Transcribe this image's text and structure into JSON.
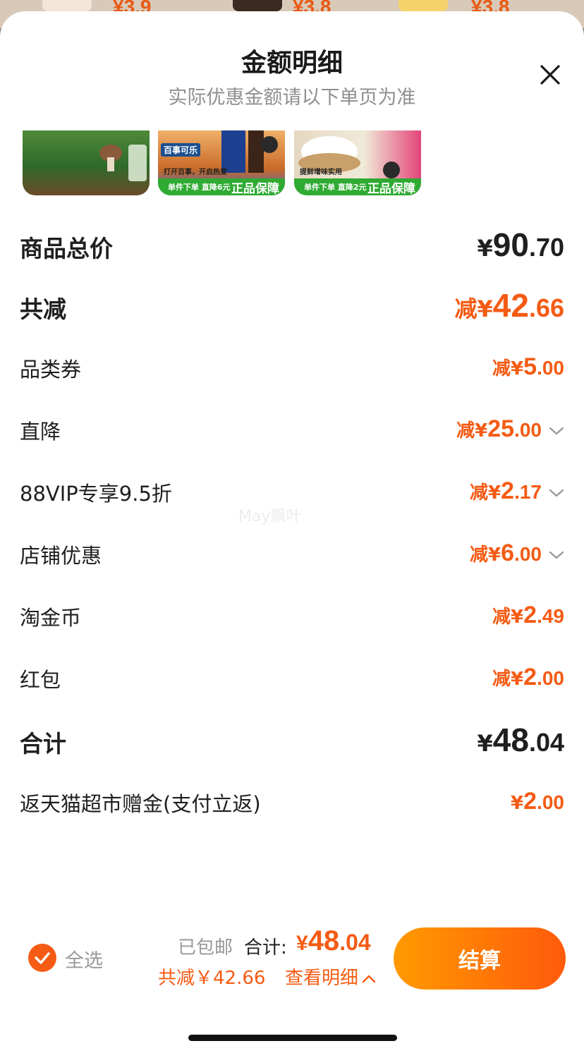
{
  "background": {
    "prices": [
      "¥3.9",
      "¥3.8",
      "¥3.8"
    ]
  },
  "sheet": {
    "title": "金额明细",
    "subtitle": "实际优惠金额请以下单页为准",
    "close_icon": "close-icon"
  },
  "thumbnails": [
    {
      "caption": "",
      "badge": "",
      "tag_left": "",
      "tag_right": ""
    },
    {
      "caption": "打开百事，开启热爱",
      "badge": "百事可乐",
      "tag_left": "单件下单 直降6元",
      "tag_right": "正品保障"
    },
    {
      "caption": "提鲜增味实用",
      "badge": "",
      "tag_left": "单件下单 直降2元",
      "tag_right": "正品保障"
    }
  ],
  "rows": {
    "subtotal": {
      "label": "商品总价",
      "prefix": "¥",
      "int": "90",
      "dec": ".70"
    },
    "total_discount": {
      "label": "共减",
      "prefix": "减¥",
      "int": "42",
      "dec": ".66"
    },
    "coupon": {
      "label": "品类券",
      "prefix": "减¥",
      "int": "5",
      "dec": ".00"
    },
    "direct": {
      "label": "直降",
      "prefix": "减¥",
      "int": "25",
      "dec": ".00"
    },
    "vip": {
      "label": "88VIP专享9.5折",
      "prefix": "减¥",
      "int": "2",
      "dec": ".17"
    },
    "store": {
      "label": "店铺优惠",
      "prefix": "减¥",
      "int": "6",
      "dec": ".00"
    },
    "coins": {
      "label": "淘金币",
      "prefix": "减¥",
      "int": "2",
      "dec": ".49"
    },
    "redpacket": {
      "label": "红包",
      "prefix": "减¥",
      "int": "2",
      "dec": ".00"
    },
    "total": {
      "label": "合计",
      "prefix": "¥",
      "int": "48",
      "dec": ".04"
    },
    "rebate": {
      "label": "返天猫超市赠金(支付立返)",
      "prefix": "¥",
      "int": "2",
      "dec": ".00"
    }
  },
  "watermark": "May飘叶",
  "footer": {
    "select_all": "全选",
    "shipping": "已包邮",
    "total_label": "合计:",
    "total_prefix": "¥",
    "total_int": "48",
    "total_dec": ".04",
    "discount": "共减￥42.66",
    "detail_link": "查看明细",
    "checkout": "结算"
  },
  "colors": {
    "accent": "#f55b14",
    "button_gradient_start": "#ff9a00",
    "button_gradient_end": "#ff5a0c",
    "muted_text": "#8f8f8f"
  }
}
